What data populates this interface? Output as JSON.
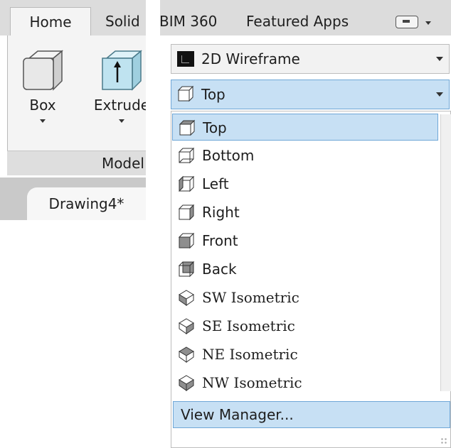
{
  "tabs": {
    "home": "Home",
    "solid": "Solid",
    "bim": "BIM 360",
    "featured": "Featured Apps"
  },
  "modeling": {
    "box_label": "Box",
    "extrude_label": "Extrude",
    "panel_title": "Model"
  },
  "document_tab": "Drawing4*",
  "visual_style": {
    "value": "2D Wireframe"
  },
  "view_dropdown": {
    "value": "Top",
    "items": [
      {
        "label": "Top",
        "icon": "top-view-icon"
      },
      {
        "label": "Bottom",
        "icon": "bottom-view-icon"
      },
      {
        "label": "Left",
        "icon": "left-view-icon"
      },
      {
        "label": "Right",
        "icon": "right-view-icon"
      },
      {
        "label": "Front",
        "icon": "front-view-icon"
      },
      {
        "label": "Back",
        "icon": "back-view-icon"
      },
      {
        "label": "SW Isometric",
        "icon": "sw-isometric-icon"
      },
      {
        "label": "SE Isometric",
        "icon": "se-isometric-icon"
      },
      {
        "label": "NE Isometric",
        "icon": "ne-isometric-icon"
      },
      {
        "label": "NW Isometric",
        "icon": "nw-isometric-icon"
      }
    ],
    "selected_index": 0,
    "view_manager": "View Manager..."
  },
  "colors": {
    "selection_fill": "#c7e0f4",
    "selection_border": "#6fa7d7",
    "cube_face": "#bfe3f0"
  }
}
